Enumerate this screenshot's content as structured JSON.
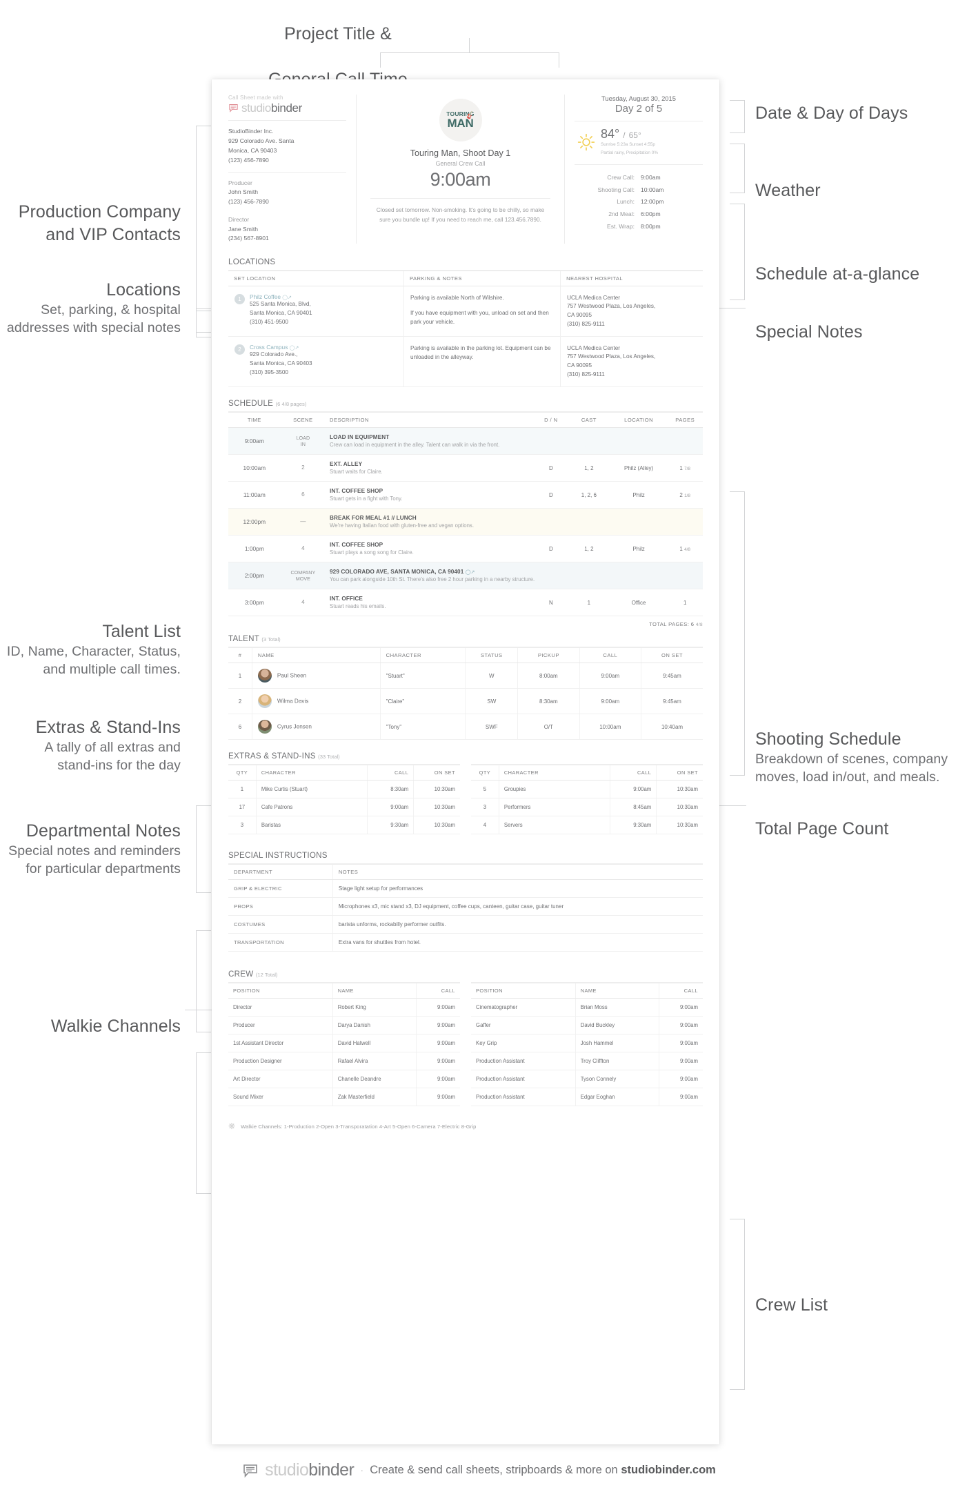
{
  "annotations": {
    "top": {
      "line1": "Project Title &",
      "line2": "General Call Time"
    },
    "right": [
      {
        "title": "Date & Day of Days",
        "sub": ""
      },
      {
        "title": "Weather",
        "sub": ""
      },
      {
        "title": "Schedule at-a-glance",
        "sub": ""
      },
      {
        "title": "Special Notes",
        "sub": ""
      },
      {
        "title": "Shooting Schedule",
        "sub": "Breakdown of scenes, company\nmoves, load in/out, and meals."
      },
      {
        "title": "Total Page Count",
        "sub": ""
      },
      {
        "title": "Crew List",
        "sub": ""
      }
    ],
    "left": [
      {
        "title": "Production Company\nand VIP Contacts",
        "sub": ""
      },
      {
        "title": "Locations",
        "sub": "Set, parking, & hospital\naddresses with special notes"
      },
      {
        "title": "Talent List",
        "sub": "ID, Name, Character, Status,\nand multiple call times."
      },
      {
        "title": "Extras & Stand-Ins",
        "sub": "A tally of all extras and\nstand-ins for the day"
      },
      {
        "title": "Departmental Notes",
        "sub": "Special notes and reminders\nfor particular departments"
      },
      {
        "title": "Walkie Channels",
        "sub": ""
      }
    ]
  },
  "header": {
    "made_with": "Call Sheet made with",
    "brand_studio": "studio",
    "brand_binder": "binder",
    "company": {
      "name": "StudioBinder Inc.",
      "address_line1": "929 Colorado Ave. Santa",
      "address_line2": "Monica, CA 90403",
      "phone": "(123) 456-7890"
    },
    "vips": [
      {
        "role": "Producer",
        "name": "John Smith",
        "phone": "(123) 456-7890"
      },
      {
        "role": "Director",
        "name": "Jane Smith",
        "phone": "(234) 567-8901"
      }
    ],
    "poster": {
      "line1": "TOURING",
      "line2": "MAN"
    },
    "project_title": "Touring Man, Shoot Day 1",
    "call_label": "General Crew Call",
    "call_time": "9:00am",
    "special_notes": "Closed set tomorrow. Non-smoking. It's going to be chilly, so make sure you bundle up!\nIf you need to reach me, call 123.456.7890.",
    "date": "Tuesday, August 30, 2015",
    "day_of_days": "Day 2 of 5",
    "weather": {
      "high": "84°",
      "sep": "/",
      "low": "65°",
      "sun": "Sunrise 5:23a  Sunset 4:55p",
      "precip": "Partial rainy, Precipitation 0%"
    },
    "schedule_glance": [
      {
        "label": "Crew Call:",
        "value": "9:00am"
      },
      {
        "label": "Shooting Call:",
        "value": "10:00am"
      },
      {
        "label": "Lunch:",
        "value": "12:00pm"
      },
      {
        "label": "2nd Meal:",
        "value": "6:00pm"
      },
      {
        "label": "Est. Wrap:",
        "value": "8:00pm"
      }
    ]
  },
  "locations": {
    "title": "LOCATIONS",
    "columns": [
      "SET LOCATION",
      "PARKING & NOTES",
      "NEAREST HOSPITAL"
    ],
    "rows": [
      {
        "pin": "1",
        "name": "Philz Coffee",
        "addr1": "525 Santa Monica, Blvd,",
        "addr2": "Santa Monica, CA 90401",
        "phone": "(310) 451-9500",
        "parking1": "Parking is available North of Wilshire.",
        "parking2": "If you have equipment with you, unload on set and then park your vehicle.",
        "hospital_name": "UCLA Medica Center",
        "hospital_addr1": "757 Westwood Plaza, Los Angeles,",
        "hospital_addr2": "CA 90095",
        "hospital_phone": "(310) 825-9111"
      },
      {
        "pin": "2",
        "name": "Cross Campus",
        "addr1": "929 Colorado Ave.,",
        "addr2": "Santa Monica, CA 90403",
        "phone": "(310) 395-3500",
        "parking1": "Parking is available in the parking lot. Equipment can be unloaded in the alleyway.",
        "parking2": "",
        "hospital_name": "UCLA Medica Center",
        "hospital_addr1": "757 Westwood Plaza, Los Angeles,",
        "hospital_addr2": "CA 90095",
        "hospital_phone": "(310) 825-9111"
      }
    ]
  },
  "schedule": {
    "title": "SCHEDULE",
    "count": "(6 4/8 pages)",
    "columns": [
      "TIME",
      "SCENE",
      "DESCRIPTION",
      "D / N",
      "CAST",
      "LOCATION",
      "PAGES"
    ],
    "rows": [
      {
        "style": "load",
        "time": "9:00am",
        "scene": "LOAD\nIN",
        "scene_small": true,
        "title": "LOAD IN EQUIPMENT",
        "desc": "Crew can load in equipment in the alley. Talent can walk in via the front.",
        "dn": "",
        "cast": "",
        "location": "",
        "pages": "",
        "pages_frac": ""
      },
      {
        "style": "",
        "time": "10:00am",
        "scene": "2",
        "scene_small": false,
        "title": "EXT. ALLEY",
        "desc": "Stuart waits for Claire.",
        "dn": "D",
        "cast": "1, 2",
        "location": "Philz (Alley)",
        "pages": "1",
        "pages_frac": "7/8"
      },
      {
        "style": "",
        "time": "11:00am",
        "scene": "6",
        "scene_small": false,
        "title": "INT. COFFEE SHOP",
        "desc": "Stuart gets in a fight with Tony.",
        "dn": "D",
        "cast": "1, 2, 6",
        "location": "Philz",
        "pages": "2",
        "pages_frac": "1/8"
      },
      {
        "style": "meal",
        "time": "12:00pm",
        "scene": "—",
        "scene_small": false,
        "title": "BREAK FOR MEAL #1 // LUNCH",
        "desc": "We're having Italian food with gluten-free and vegan options.",
        "dn": "",
        "cast": "",
        "location": "",
        "pages": "",
        "pages_frac": ""
      },
      {
        "style": "",
        "time": "1:00pm",
        "scene": "4",
        "scene_small": false,
        "title": "INT. COFFEE SHOP",
        "desc": "Stuart plays a song song for Claire.",
        "dn": "D",
        "cast": "1, 2",
        "location": "Philz",
        "pages": "1",
        "pages_frac": "4/8"
      },
      {
        "style": "move",
        "time": "2:00pm",
        "scene": "COMPANY\nMOVE",
        "scene_small": true,
        "title": "929 COLORADO AVE, SANTA MONICA, CA 90401",
        "desc": "You can park alongside 10th St. There's also free 2 hour parking in a nearby structure.",
        "dn": "",
        "cast": "",
        "location": "",
        "pages": "",
        "pages_frac": "",
        "link": true
      },
      {
        "style": "",
        "time": "3:00pm",
        "scene": "4",
        "scene_small": false,
        "title": "INT. OFFICE",
        "desc": "Stuart reads his emails.",
        "dn": "N",
        "cast": "1",
        "location": "Office",
        "pages": "1",
        "pages_frac": ""
      }
    ],
    "total_label": "TOTAL PAGES:",
    "total_value": "6",
    "total_frac": "4/8"
  },
  "talent": {
    "title": "TALENT",
    "count": "(3 Total)",
    "columns": [
      "#",
      "NAME",
      "CHARACTER",
      "STATUS",
      "PICKUP",
      "CALL",
      "ON SET"
    ],
    "rows": [
      {
        "id": "1",
        "avatar": "av1",
        "name": "Paul Sheen",
        "character": "\"Stuart\"",
        "status": "W",
        "pickup": "8:00am",
        "call": "9:00am",
        "onset": "9:45am"
      },
      {
        "id": "2",
        "avatar": "av2",
        "name": "Wilma Davis",
        "character": "\"Claire\"",
        "status": "SW",
        "pickup": "8:30am",
        "call": "9:00am",
        "onset": "9:45am"
      },
      {
        "id": "6",
        "avatar": "av3",
        "name": "Cyrus Jensen",
        "character": "\"Tony\"",
        "status": "SWF",
        "pickup": "O/T",
        "call": "10:00am",
        "onset": "10:40am"
      }
    ]
  },
  "extras": {
    "title": "EXTRAS & STAND-INS",
    "count": "(33 Total)",
    "columns": [
      "QTY",
      "CHARACTER",
      "CALL",
      "ON SET"
    ],
    "left_rows": [
      {
        "qty": "1",
        "character": "Mike Curtis (Stuart)",
        "call": "8:30am",
        "onset": "10:30am"
      },
      {
        "qty": "17",
        "character": "Cafe Patrons",
        "call": "9:00am",
        "onset": "10:30am"
      },
      {
        "qty": "3",
        "character": "Baristas",
        "call": "9:30am",
        "onset": "10:30am"
      }
    ],
    "right_rows": [
      {
        "qty": "5",
        "character": "Groupies",
        "call": "9:00am",
        "onset": "10:30am"
      },
      {
        "qty": "3",
        "character": "Performers",
        "call": "8:45am",
        "onset": "10:30am"
      },
      {
        "qty": "4",
        "character": "Servers",
        "call": "9:30am",
        "onset": "10:30am"
      }
    ]
  },
  "special_instructions": {
    "title": "SPECIAL INSTRUCTIONS",
    "columns": [
      "DEPARTMENT",
      "NOTES"
    ],
    "rows": [
      {
        "dept": "GRIP & ELECTRIC",
        "note": "Stage light setup for performances"
      },
      {
        "dept": "PROPS",
        "note": "Microphones x3, mic stand x3, DJ equipment, coffee cups, canteen, guitar case, guitar tuner"
      },
      {
        "dept": "COSTUMES",
        "note": "barista unforms, rockabilly performer outfits."
      },
      {
        "dept": "TRANSPORTATION",
        "note": "Extra vans for shuttles from hotel."
      }
    ]
  },
  "crew": {
    "title": "CREW",
    "count": "(12 Total)",
    "columns": [
      "POSITION",
      "NAME",
      "CALL"
    ],
    "left_rows": [
      {
        "position": "Director",
        "name": "Robert King",
        "call": "9:00am"
      },
      {
        "position": "Producer",
        "name": "Darya Danish",
        "call": "9:00am"
      },
      {
        "position": "1st Assistant Director",
        "name": "David Hatwell",
        "call": "9:00am"
      },
      {
        "position": "Production Designer",
        "name": "Rafael Alvira",
        "call": "9:00am"
      },
      {
        "position": "Art Director",
        "name": "Chanelle Deandre",
        "call": "9:00am"
      },
      {
        "position": "Sound Mixer",
        "name": "Zak Masterfield",
        "call": "9:00am"
      }
    ],
    "right_rows": [
      {
        "position": "Cinematographer",
        "name": "Brian Moss",
        "call": "9:00am"
      },
      {
        "position": "Gaffer",
        "name": "David Buckley",
        "call": "9:00am"
      },
      {
        "position": "Key Grip",
        "name": "Josh Hammel",
        "call": "9:00am"
      },
      {
        "position": "Production Assistant",
        "name": "Troy Cliffton",
        "call": "9:00am"
      },
      {
        "position": "Production Assistant",
        "name": "Tyson Connely",
        "call": "9:00am"
      },
      {
        "position": "Production Assistant",
        "name": "Edgar Eoghan",
        "call": "9:00am"
      }
    ]
  },
  "walkie": {
    "text": "Walkie Channels: 1-Production  2-Open  3-Transporatation  4-Art  5-Open  6-Camera  7-Electric  8-Grip"
  },
  "footer": {
    "brand_studio": "studio",
    "brand_binder": "binder",
    "separator": "·",
    "tagline_pre": "Create & send call sheets, stripboards & more on ",
    "tagline_url": "studiobinder.com"
  },
  "colors": {
    "accent_teal": "#3f6b66",
    "link_blue": "#8fb3bd",
    "text": "#6e6f72",
    "muted": "#a2a3a5",
    "rule": "#ececec",
    "row_load": "#f5f9fa",
    "row_meal": "#fdfbf2",
    "row_move": "#f3f7f9"
  }
}
